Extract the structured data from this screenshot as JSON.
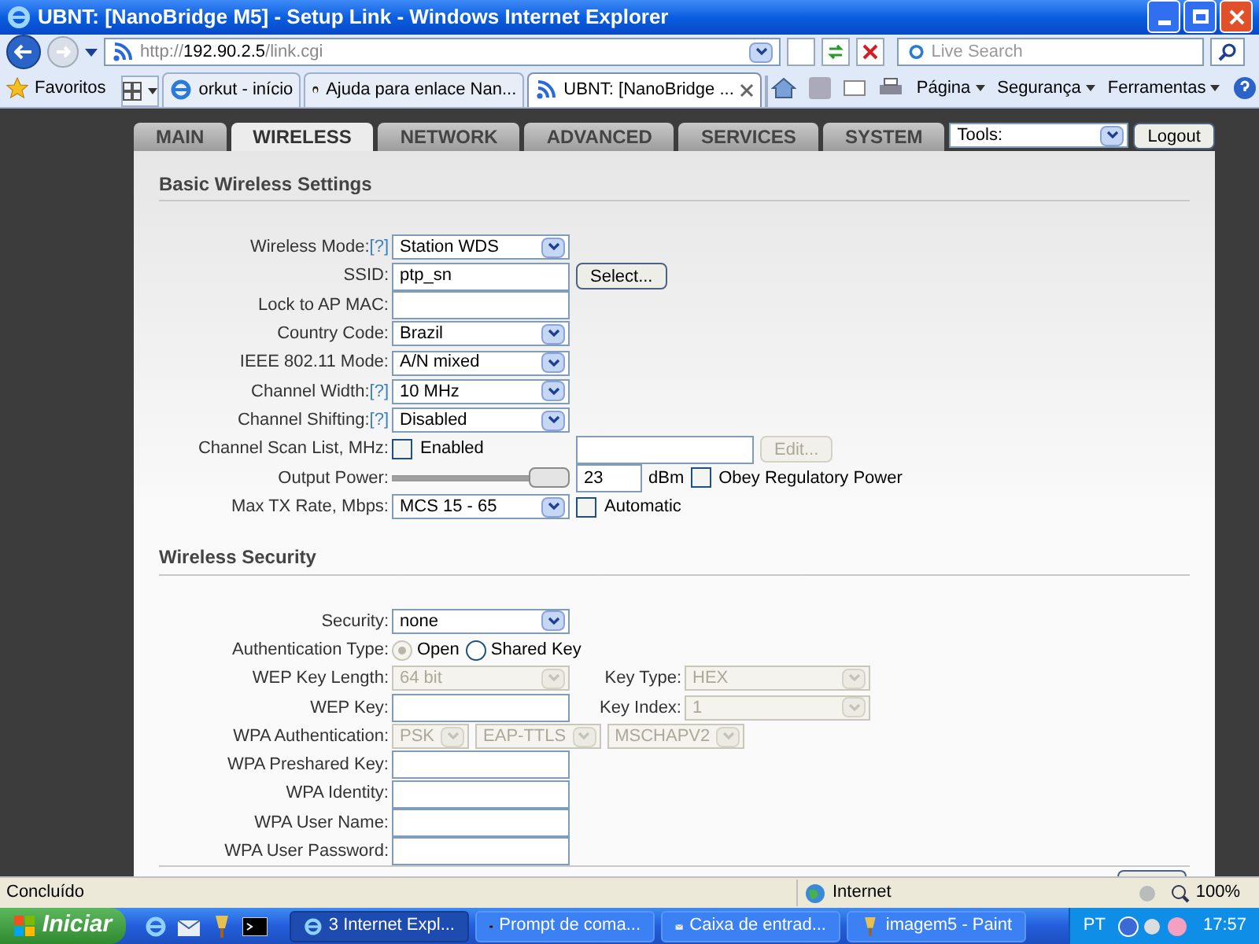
{
  "window": {
    "title": "UBNT: [NanoBridge M5] - Setup Link - Windows Internet Explorer"
  },
  "address_bar": {
    "scheme": "http://",
    "host": "192.90.2.5",
    "path": "/link.cgi"
  },
  "search": {
    "placeholder": "Live Search"
  },
  "favorites": {
    "label": "Favoritos"
  },
  "browser_tabs": [
    {
      "label": "orkut - início",
      "selected": false
    },
    {
      "label": "Ajuda para enlace Nan...",
      "selected": false
    },
    {
      "label": "UBNT: [NanoBridge ...",
      "selected": true
    }
  ],
  "command_bar": [
    "Página",
    "Segurança",
    "Ferramentas"
  ],
  "page_tabs": [
    {
      "label": "MAIN",
      "selected": false
    },
    {
      "label": "WIRELESS",
      "selected": true
    },
    {
      "label": "NETWORK",
      "selected": false
    },
    {
      "label": "ADVANCED",
      "selected": false
    },
    {
      "label": "SERVICES",
      "selected": false
    },
    {
      "label": "SYSTEM",
      "selected": false
    }
  ],
  "tools": {
    "value": "Tools:"
  },
  "logout": "Logout",
  "sections": [
    {
      "title": "Basic Wireless Settings",
      "rows": [
        {
          "label": "Wireless Mode:",
          "help": "[?]",
          "controls": [
            {
              "kind": "select",
              "value": "Station WDS",
              "disabled": false
            }
          ]
        },
        {
          "label": "SSID:",
          "controls": [
            {
              "kind": "input",
              "value": "ptp_sn"
            },
            {
              "kind": "button",
              "label": "Select...",
              "disabled": false
            }
          ]
        },
        {
          "label": "Lock to AP MAC:",
          "controls": [
            {
              "kind": "input"
            }
          ]
        },
        {
          "label": "Country Code:",
          "controls": [
            {
              "kind": "select",
              "value": "Brazil",
              "disabled": false
            }
          ]
        },
        {
          "label": "IEEE 802.11 Mode:",
          "controls": [
            {
              "kind": "select",
              "value": "A/N mixed",
              "disabled": false
            }
          ]
        },
        {
          "label": "Channel Width:",
          "help": "[?]",
          "controls": [
            {
              "kind": "select",
              "value": "10 MHz",
              "disabled": false
            }
          ]
        },
        {
          "label": "Channel Shifting:",
          "help": "[?]",
          "controls": [
            {
              "kind": "select",
              "value": "Disabled",
              "disabled": false
            }
          ]
        },
        {
          "label": "Channel Scan List, MHz:",
          "controls": [
            {
              "kind": "checkbox",
              "label": "Enabled",
              "checked": false
            },
            {
              "kind": "input"
            },
            {
              "kind": "button",
              "label": "Edit...",
              "disabled": true
            }
          ]
        },
        {
          "label": "Output Power:",
          "controls": [
            {
              "kind": "slider",
              "level": 1
            },
            {
              "kind": "numberfield",
              "value": "23"
            },
            {
              "kind": "unit",
              "text": "dBm"
            },
            {
              "kind": "checkbox",
              "label": "Obey Regulatory Power",
              "checked": false
            }
          ]
        },
        {
          "label": "Max TX Rate, Mbps:",
          "controls": [
            {
              "kind": "select",
              "value": "MCS 15 - 65",
              "disabled": false
            },
            {
              "kind": "checkbox",
              "label": "Automatic",
              "checked": false
            }
          ]
        }
      ]
    },
    {
      "title": "Wireless Security",
      "rows": [
        {
          "label": "Security:",
          "controls": [
            {
              "kind": "select",
              "value": "none",
              "disabled": false
            }
          ]
        },
        {
          "label": "Authentication Type:",
          "controls": [
            {
              "kind": "radio",
              "label": "Open",
              "selected": true,
              "disabled": true
            },
            {
              "kind": "radio",
              "label": "Shared Key",
              "selected": false,
              "disabled": false
            }
          ]
        },
        {
          "label": "WEP Key Length:",
          "controls": [
            {
              "kind": "select",
              "value": "64 bit",
              "disabled": true
            }
          ],
          "side": {
            "label": "Key Type:",
            "controls": [
              {
                "kind": "select",
                "value": "HEX",
                "disabled": true
              }
            ]
          }
        },
        {
          "label": "WEP Key:",
          "controls": [
            {
              "kind": "input"
            }
          ],
          "side": {
            "label": "Key Index:",
            "controls": [
              {
                "kind": "select",
                "value": "1",
                "disabled": true
              }
            ]
          }
        },
        {
          "label": "WPA Authentication:",
          "controls": [
            {
              "kind": "miniselect",
              "value": "PSK",
              "disabled": true
            },
            {
              "kind": "miniselect",
              "value": "EAP-TTLS",
              "disabled": true
            },
            {
              "kind": "miniselect",
              "value": "MSCHAPV2",
              "disabled": true
            }
          ]
        },
        {
          "label": "WPA Preshared Key:",
          "controls": [
            {
              "kind": "input"
            }
          ]
        },
        {
          "label": "WPA Identity:",
          "controls": [
            {
              "kind": "input"
            }
          ]
        },
        {
          "label": "WPA User Name:",
          "controls": [
            {
              "kind": "input"
            }
          ]
        },
        {
          "label": "WPA User Password:",
          "controls": [
            {
              "kind": "input"
            }
          ]
        }
      ]
    }
  ],
  "status_bar": {
    "text": "Concluído",
    "zone": "Internet",
    "zoom": "100%"
  },
  "taskbar": {
    "start": "Iniciar",
    "tasks": [
      {
        "label": "3 Internet Expl...",
        "selected": true
      },
      {
        "label": "Prompt de coma...",
        "selected": false
      },
      {
        "label": "Caixa de entrad...",
        "selected": false
      },
      {
        "label": "imagem5 - Paint",
        "selected": false
      }
    ],
    "language": "PT",
    "clock": "17:57"
  }
}
